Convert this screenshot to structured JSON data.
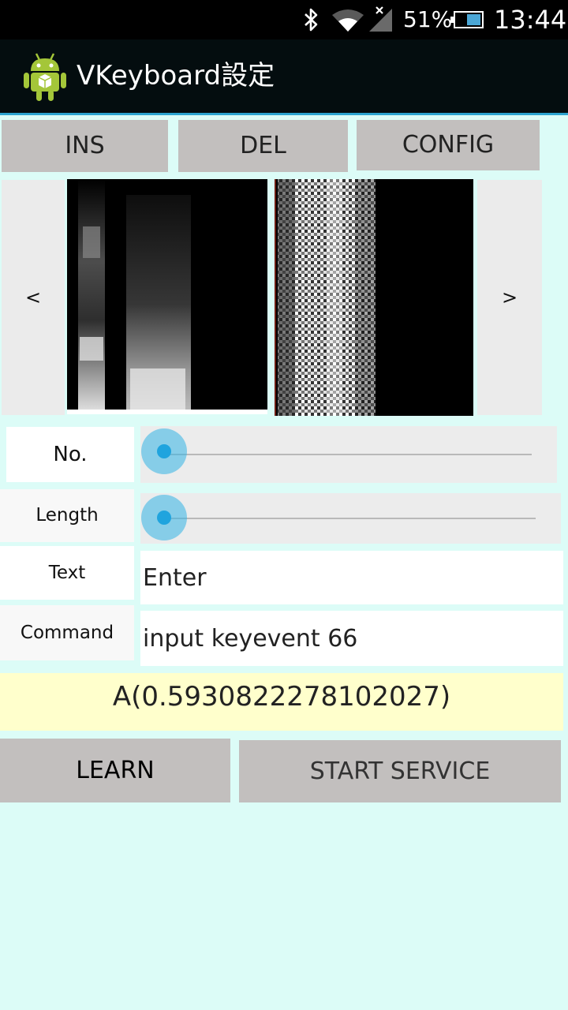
{
  "status_bar": {
    "battery_percent": "51%",
    "time": "13:44",
    "icons": [
      "bluetooth-icon",
      "wifi-icon",
      "cellular-signal-icon",
      "battery-icon"
    ]
  },
  "action_bar": {
    "title": "VKeyboard設定",
    "app_icon": "android-robot-icon"
  },
  "toolbar": {
    "ins_label": "INS",
    "del_label": "DEL",
    "config_label": "CONFIG"
  },
  "carousel": {
    "prev_label": "<",
    "next_label": ">",
    "images": [
      "spectrogram-image",
      "spectrogram-image"
    ]
  },
  "form": {
    "no_label": "No.",
    "no_value": 0,
    "length_label": "Length",
    "length_value": 0,
    "text_label": "Text",
    "text_value": "Enter",
    "command_label": "Command",
    "command_value": "input keyevent 66"
  },
  "result_text": "A(0.5930822278102027)",
  "actions": {
    "learn_label": "LEARN",
    "start_label": "START SERVICE"
  },
  "colors": {
    "background": "#dcfcf7",
    "accent": "#33b5e5",
    "button": "#c2bfbe",
    "result_bg": "#ffffcc"
  }
}
